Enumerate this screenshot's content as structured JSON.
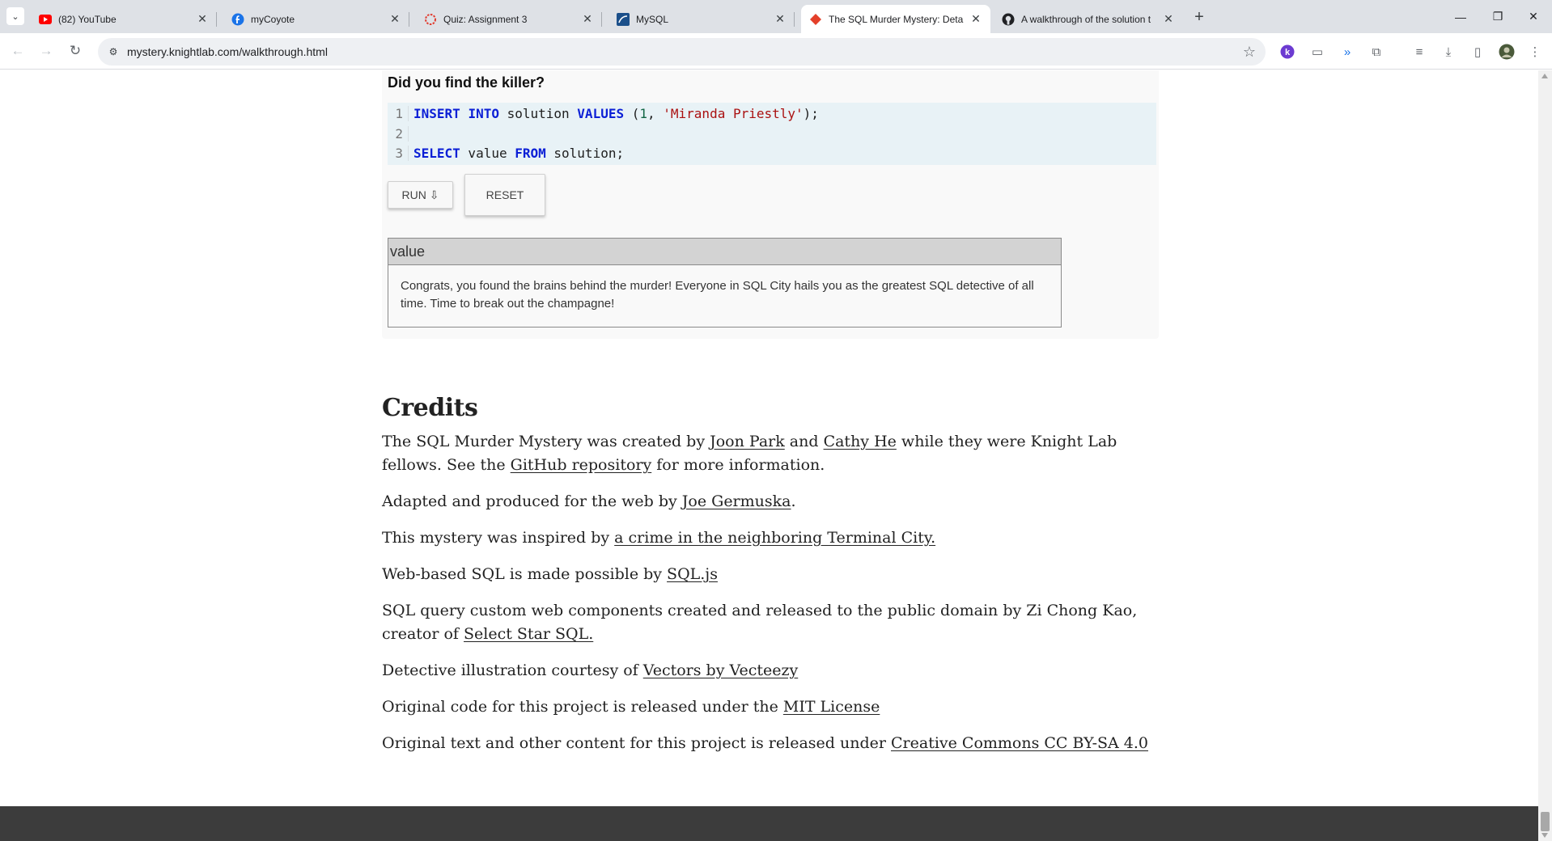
{
  "browser": {
    "tabs": [
      {
        "title": "(82) YouTube",
        "icon": "youtube-icon",
        "color": "#ff0000"
      },
      {
        "title": "myCoyote",
        "icon": "mycoyote-icon",
        "color": "#1a73e8"
      },
      {
        "title": "Quiz: Assignment 3",
        "icon": "canvas-icon",
        "color": "#e13b2e"
      },
      {
        "title": "MySQL",
        "icon": "mysql-icon",
        "color": "#1b4f8a"
      },
      {
        "title": "The SQL Murder Mystery: Deta",
        "icon": "knightlab-icon",
        "color": "#e4402a"
      },
      {
        "title": "A walkthrough of the solution t",
        "icon": "github-icon",
        "color": "#202124"
      }
    ],
    "active_tab": 4,
    "url": "mystery.knightlab.com/walkthrough.html"
  },
  "walkthrough": {
    "heading": "Did you find the killer?",
    "code_lines": [
      {
        "n": "1",
        "text": "INSERT INTO solution VALUES (1, 'Miranda Priestly');"
      },
      {
        "n": "2",
        "text": ""
      },
      {
        "n": "3",
        "text": "SELECT value FROM solution;"
      }
    ],
    "run_label": "RUN ⇩",
    "reset_label": "RESET",
    "result_header": "value",
    "result_text": "Congrats, you found the brains behind the murder! Everyone in SQL City hails you as the greatest SQL detective of all time. Time to break out the champagne!"
  },
  "credits": {
    "title": "Credits",
    "p1": {
      "t1": "The SQL Murder Mystery was created by ",
      "link1": "Joon Park",
      "t2": " and ",
      "link2": "Cathy He",
      "t3": " while they were Knight Lab fellows. See the ",
      "link3": "GitHub repository",
      "t4": " for more information."
    },
    "p2": {
      "t1": "Adapted and produced for the web by ",
      "link1": "Joe Germuska",
      "t2": "."
    },
    "p3": {
      "t1": "This mystery was inspired by ",
      "link1": "a crime in the neighboring Terminal City."
    },
    "p4": {
      "t1": "Web-based SQL is made possible by ",
      "link1": "SQL.js"
    },
    "p5": {
      "t1": "SQL query custom web components created and released to the public domain by Zi Chong Kao, creator of ",
      "link1": "Select Star SQL."
    },
    "p6": {
      "t1": "Detective illustration courtesy of ",
      "link1": "Vectors by Vecteezy"
    },
    "p7": {
      "t1": "Original code for this project is released under the ",
      "link1": "MIT License"
    },
    "p8": {
      "t1": "Original text and other content for this project is released under ",
      "link1": "Creative Commons CC BY-SA 4.0"
    }
  }
}
